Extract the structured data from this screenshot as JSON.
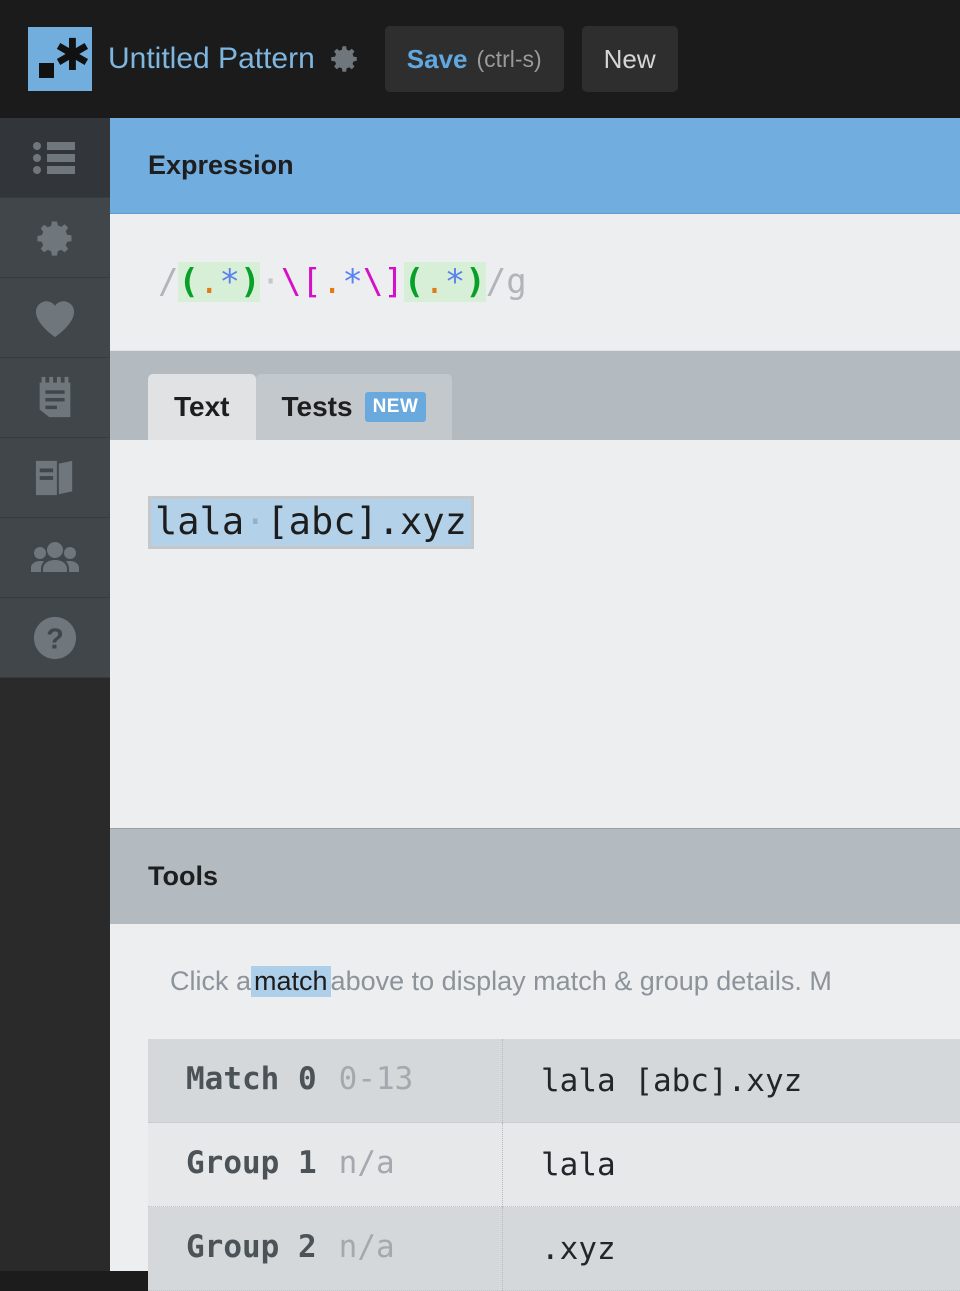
{
  "header": {
    "logo_icon": "regexr-asterisk-logo",
    "title": "Untitled Pattern",
    "settings_icon": "gear-icon",
    "save": {
      "label": "Save",
      "shortcut": "(ctrl-s)"
    },
    "new": {
      "label": "New"
    }
  },
  "sidebar": {
    "items": [
      {
        "icon": "list-icon",
        "name": "sidebar-item-list",
        "active": true
      },
      {
        "icon": "gear-icon",
        "name": "sidebar-item-settings",
        "active": false
      },
      {
        "icon": "heart-icon",
        "name": "sidebar-item-favorites",
        "active": false
      },
      {
        "icon": "notepad-icon",
        "name": "sidebar-item-cheatsheet",
        "active": false
      },
      {
        "icon": "book-icon",
        "name": "sidebar-item-reference",
        "active": false
      },
      {
        "icon": "people-icon",
        "name": "sidebar-item-community",
        "active": false
      },
      {
        "icon": "help-icon",
        "name": "sidebar-item-help",
        "active": false
      }
    ]
  },
  "expression": {
    "panel_title": "Expression",
    "full": "/(.*)\\s\\[.*\\](.*)/g",
    "open_delim": "/",
    "close_delim": "/",
    "flags": "g",
    "tokens": [
      {
        "t": "(",
        "cls": "paren",
        "group": 1
      },
      {
        "t": ".",
        "cls": "dot",
        "group": 1
      },
      {
        "t": "*",
        "cls": "star",
        "group": 1
      },
      {
        "t": ")",
        "cls": "paren",
        "group": 1
      },
      {
        "t": "·",
        "cls": "space-dot",
        "group": 0
      },
      {
        "t": "\\[",
        "cls": "bracket",
        "group": 0
      },
      {
        "t": ".",
        "cls": "dot",
        "group": 0
      },
      {
        "t": "*",
        "cls": "star",
        "group": 0
      },
      {
        "t": "\\]",
        "cls": "bracket",
        "group": 0
      },
      {
        "t": "(",
        "cls": "paren",
        "group": 2
      },
      {
        "t": ".",
        "cls": "dot",
        "group": 2
      },
      {
        "t": "*",
        "cls": "star",
        "group": 2
      },
      {
        "t": ")",
        "cls": "paren",
        "group": 2
      }
    ],
    "colors": {
      "delimiter": "#b0b5ba",
      "group_paren": "#09a02a",
      "group_bg": "#d6efd6",
      "dot": "#e07b18",
      "quantifier": "#5b82ef",
      "bracket": "#d411c6",
      "space_dot": "#c3c7cb"
    }
  },
  "tabs": [
    {
      "label": "Text",
      "active": true,
      "badge": null
    },
    {
      "label": "Tests",
      "active": false,
      "badge": "NEW"
    }
  ],
  "text_panel": {
    "content": "lala [abc].xyz",
    "before_space": "lala",
    "space_glyph": "·",
    "after_space": "[abc].xyz",
    "highlight_color": "#b3d2ea"
  },
  "tools": {
    "panel_title": "Tools",
    "description_prefix": "Click a ",
    "description_highlight": "match",
    "description_suffix": " above to display match & group details. M",
    "rows": [
      {
        "name": "Match 0",
        "range": "0-13",
        "value": "lala [abc].xyz"
      },
      {
        "name": "Group 1",
        "range": "n/a",
        "value": "lala"
      },
      {
        "name": "Group 2",
        "range": "n/a",
        "value": ".xyz"
      }
    ]
  }
}
